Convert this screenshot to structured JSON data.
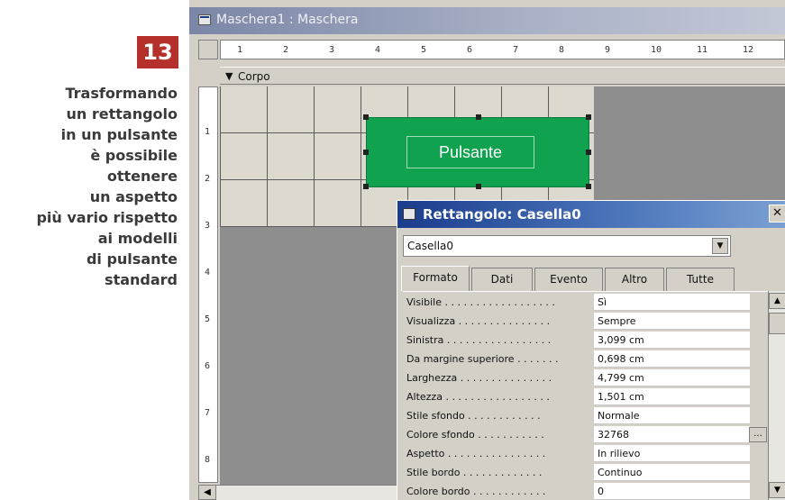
{
  "caption": {
    "number": "13",
    "lines": [
      "Trasformando",
      "un rettangolo",
      "in un pulsante",
      "è possibile",
      "ottenere",
      "un aspetto",
      "più vario rispetto",
      "ai modelli",
      "di pulsante",
      "standard"
    ]
  },
  "window": {
    "title": "Maschera1 : Maschera",
    "section": "Corpo",
    "ruler_h": [
      "1",
      "2",
      "3",
      "4",
      "5",
      "6",
      "7",
      "8",
      "9",
      "10",
      "11",
      "12"
    ],
    "ruler_v": [
      "1",
      "2",
      "3",
      "4",
      "5",
      "6",
      "7",
      "8"
    ]
  },
  "button": {
    "label": "Pulsante",
    "fill_color": "#10a24e"
  },
  "property_sheet": {
    "title": "Rettangolo: Casella0",
    "object_selected": "Casella0",
    "tabs": [
      "Formato",
      "Dati",
      "Evento",
      "Altro",
      "Tutte"
    ],
    "active_tab": "Formato",
    "properties": [
      {
        "name": "Visibile . . . . . . . . . . . . . . . . . .",
        "value": "Sì"
      },
      {
        "name": "Visualizza . . . . . . . . . . . . . . .",
        "value": "Sempre"
      },
      {
        "name": "Sinistra . . . . . . . . . . . . . . . . .",
        "value": "3,099 cm"
      },
      {
        "name": "Da margine superiore . . . . . . .",
        "value": "0,698 cm"
      },
      {
        "name": "Larghezza . . . . . . . . . . . . . . .",
        "value": "4,799 cm"
      },
      {
        "name": "Altezza . . . . . . . . . . . . . . . . .",
        "value": "1,501 cm"
      },
      {
        "name": "Stile sfondo . . . . . . . . . . . .",
        "value": "Normale"
      },
      {
        "name": "Colore sfondo . . . . . . . . . . .",
        "value": "32768"
      },
      {
        "name": "Aspetto . . . . . . . . . . . . . . . .",
        "value": "In rilievo"
      },
      {
        "name": "Stile bordo . . . . . . . . . . . . .",
        "value": "Continuo"
      },
      {
        "name": "Colore bordo . . . . . . . . . . . .",
        "value": "0"
      }
    ]
  }
}
